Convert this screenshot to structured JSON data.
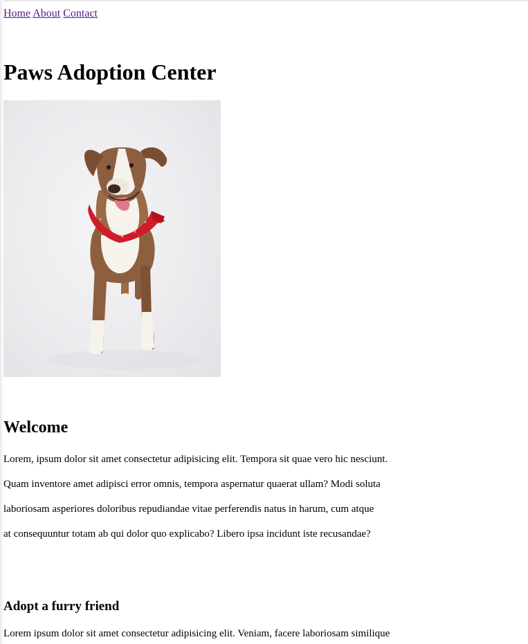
{
  "nav": {
    "links": [
      "Home",
      "About",
      "Contact"
    ]
  },
  "page": {
    "title": "Paws Adoption Center"
  },
  "hero_image": {
    "alt": "dog-photo",
    "bandana_color": "#d11a2a"
  },
  "welcome": {
    "heading": "Welcome",
    "lines": [
      "Lorem, ipsum dolor sit amet consectetur adipisicing elit. Tempora sit quae vero hic nesciunt.",
      "Quam inventore amet adipisci error omnis, tempora aspernatur quaerat ullam? Modi soluta",
      "laboriosam asperiores doloribus repudiandae vitae perferendis natus in harum, cum atque",
      "at consequuntur totam ab qui dolor quo explicabo? Libero ipsa incidunt iste recusandae?"
    ]
  },
  "adopt": {
    "heading": "Adopt a furry friend",
    "text": "Lorem ipsum dolor sit amet consectetur adipisicing elit. Veniam, facere laboriosam similique"
  },
  "colors": {
    "link_visited": "#551a8b",
    "text": "#000000",
    "background": "#ffffff"
  }
}
